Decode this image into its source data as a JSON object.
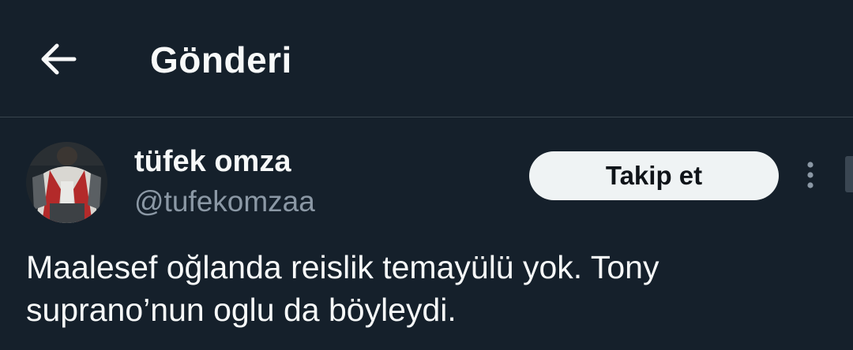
{
  "header": {
    "back_icon": "arrow-left-icon",
    "title": "Gönderi"
  },
  "author": {
    "display_name": "tüfek omza",
    "handle": "@tufekomzaa",
    "avatar": "profile-photo"
  },
  "follow_button": {
    "label": "Takip et"
  },
  "more_icon": "more-vertical-icon",
  "tweet": {
    "text": "Maalesef oğlanda reislik temayülü yok. Tony suprano’nun oglu da böyleydi."
  },
  "colors": {
    "background": "#15202b",
    "text": "#f7f9f9",
    "secondary_text": "#8b98a5",
    "divider": "#38444d",
    "button_bg": "#eff3f4",
    "button_text": "#0f1419"
  }
}
